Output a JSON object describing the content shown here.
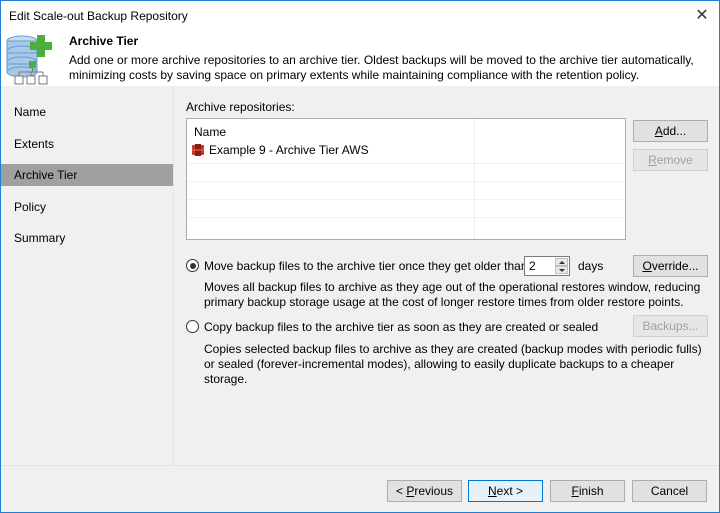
{
  "window": {
    "title": "Edit Scale-out Backup Repository",
    "close_glyph": "✕"
  },
  "header": {
    "icon": "scale-out-repository-add-icon",
    "title": "Archive Tier",
    "description": "Add one or more archive repositories to an archive tier. Oldest backups will be moved to the archive tier automatically, minimizing costs by saving space on primary extents while maintaining compliance with the retention policy."
  },
  "sidebar": {
    "items": [
      {
        "label": "Name",
        "active": false
      },
      {
        "label": "Extents",
        "active": false
      },
      {
        "label": "Archive Tier",
        "active": true
      },
      {
        "label": "Policy",
        "active": false
      },
      {
        "label": "Summary",
        "active": false
      }
    ]
  },
  "repositories": {
    "label": "Archive repositories:",
    "columns": [
      "Name",
      ""
    ],
    "rows": [
      {
        "name": "Example 9 - Archive Tier AWS",
        "icon": "aws-s3-icon"
      }
    ],
    "add_label": "Add...",
    "remove_label": "Remove"
  },
  "options": {
    "move": {
      "label": "Move backup files to the archive tier once they get older than",
      "selected": true,
      "days_value": "2",
      "days_unit": "days",
      "override_label": "Override...",
      "description": "Moves all backup files to archive as they age out of the operational restores window, reducing primary backup storage usage at the cost of longer restore times from older restore points."
    },
    "copy": {
      "label": "Copy backup files to the archive tier as soon as they are created or sealed",
      "selected": false,
      "backups_label": "Backups...",
      "description": "Copies selected backup files to archive as they are created (backup modes with periodic fulls) or sealed (forever-incremental modes), allowing to easily duplicate backups to a cheaper storage."
    }
  },
  "footer": {
    "previous_label": "< Previous",
    "next_label": "Next >",
    "finish_label": "Finish",
    "cancel_label": "Cancel"
  },
  "colors": {
    "window_border": "#1e7fd4",
    "sidebar_active": "#a0a0a0",
    "plus_green": "#4caf3c",
    "db_blue": "#a8c8e8",
    "aws_red": "#c4372a"
  }
}
